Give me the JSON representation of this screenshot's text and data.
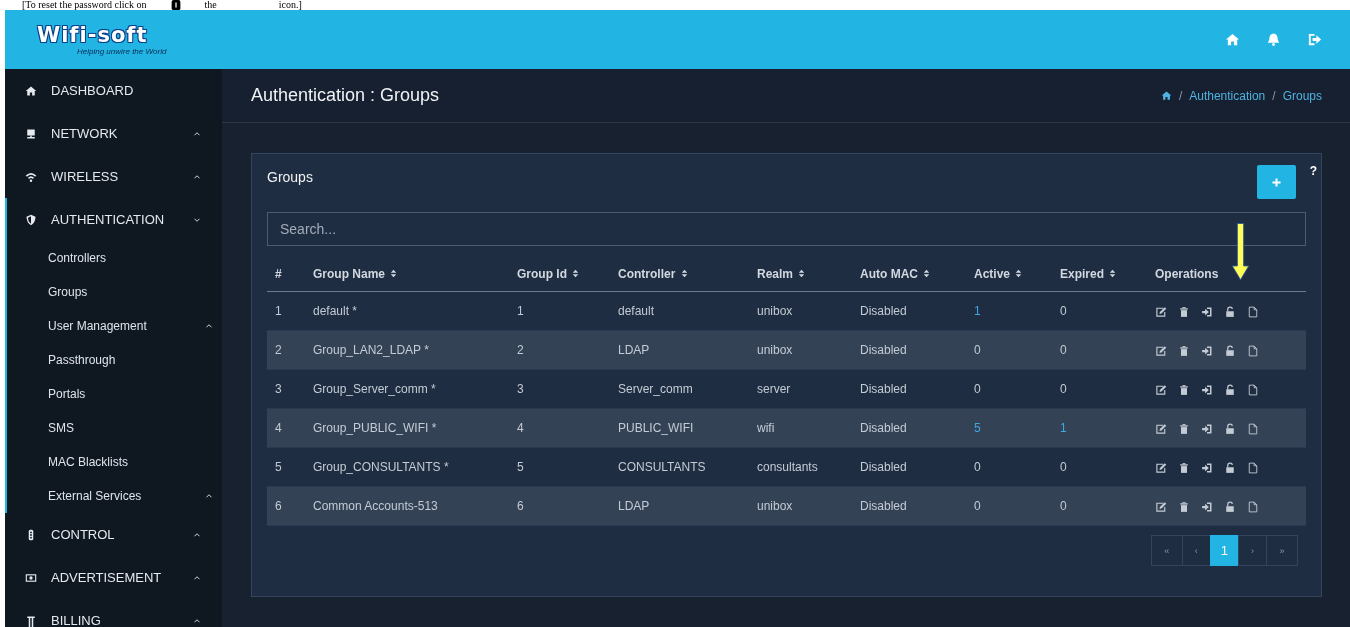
{
  "caption": {
    "before": "[To reset the password click on",
    "middle": "the",
    "after": "icon.]"
  },
  "header": {
    "logo": "Wifi-soft",
    "tagline": "Helping unwire the World"
  },
  "sidebar": {
    "items": [
      {
        "label": "DASHBOARD"
      },
      {
        "label": "NETWORK",
        "expanded": false
      },
      {
        "label": "WIRELESS",
        "expanded": false
      },
      {
        "label": "AUTHENTICATION",
        "expanded": true,
        "children": [
          {
            "label": "Controllers"
          },
          {
            "label": "Groups"
          },
          {
            "label": "User Management",
            "expanded": false
          },
          {
            "label": "Passthrough"
          },
          {
            "label": "Portals"
          },
          {
            "label": "SMS"
          },
          {
            "label": "MAC Blacklists"
          },
          {
            "label": "External Services",
            "expanded": false
          }
        ]
      },
      {
        "label": "CONTROL",
        "expanded": false
      },
      {
        "label": "ADVERTISEMENT",
        "expanded": false
      },
      {
        "label": "BILLING",
        "expanded": false
      }
    ]
  },
  "page": {
    "title": "Authentication : Groups",
    "breadcrumb": [
      {
        "kind": "separator",
        "text": "/"
      },
      {
        "kind": "link",
        "text": "Authentication"
      },
      {
        "kind": "separator",
        "text": "/"
      },
      {
        "kind": "link",
        "text": "Groups"
      }
    ]
  },
  "panel": {
    "title": "Groups",
    "help": "?",
    "search": {
      "placeholder": "Search..."
    },
    "table": {
      "columns": [
        {
          "label": "#",
          "sortable": false
        },
        {
          "label": "Group Name",
          "sortable": true
        },
        {
          "label": "Group Id",
          "sortable": true
        },
        {
          "label": "Controller",
          "sortable": true
        },
        {
          "label": "Realm",
          "sortable": true
        },
        {
          "label": "Auto MAC",
          "sortable": true
        },
        {
          "label": "Active",
          "sortable": true
        },
        {
          "label": "Expired",
          "sortable": true
        },
        {
          "label": "Operations",
          "sortable": false
        }
      ],
      "rows": [
        {
          "cells": [
            "1",
            "default *",
            "1",
            "default",
            "unibox",
            "Disabled"
          ],
          "active": {
            "text": "1",
            "link": true
          },
          "expired": {
            "text": "0",
            "link": false
          }
        },
        {
          "cells": [
            "2",
            "Group_LAN2_LDAP *",
            "2",
            "LDAP",
            "unibox",
            "Disabled"
          ],
          "active": {
            "text": "0",
            "link": false
          },
          "expired": {
            "text": "0",
            "link": false
          }
        },
        {
          "cells": [
            "3",
            "Group_Server_comm *",
            "3",
            "Server_comm",
            "server",
            "Disabled"
          ],
          "active": {
            "text": "0",
            "link": false
          },
          "expired": {
            "text": "0",
            "link": false
          }
        },
        {
          "cells": [
            "4",
            "Group_PUBLIC_WIFI *",
            "4",
            "PUBLIC_WIFI",
            "wifi",
            "Disabled"
          ],
          "active": {
            "text": "5",
            "link": true
          },
          "expired": {
            "text": "1",
            "link": true
          }
        },
        {
          "cells": [
            "5",
            "Group_CONSULTANTS *",
            "5",
            "CONSULTANTS",
            "consultants",
            "Disabled"
          ],
          "active": {
            "text": "0",
            "link": false
          },
          "expired": {
            "text": "0",
            "link": false
          }
        },
        {
          "cells": [
            "6",
            "Common Accounts-513",
            "6",
            "LDAP",
            "unibox",
            "Disabled"
          ],
          "active": {
            "text": "0",
            "link": false
          },
          "expired": {
            "text": "0",
            "link": false
          }
        }
      ]
    },
    "pagination": [
      {
        "label": "«",
        "kind": "first",
        "selected": false
      },
      {
        "label": "‹",
        "kind": "prev",
        "selected": false
      },
      {
        "label": "1",
        "kind": "page",
        "selected": true
      },
      {
        "label": "›",
        "kind": "next",
        "selected": false
      },
      {
        "label": "»",
        "kind": "last",
        "selected": false
      }
    ]
  }
}
